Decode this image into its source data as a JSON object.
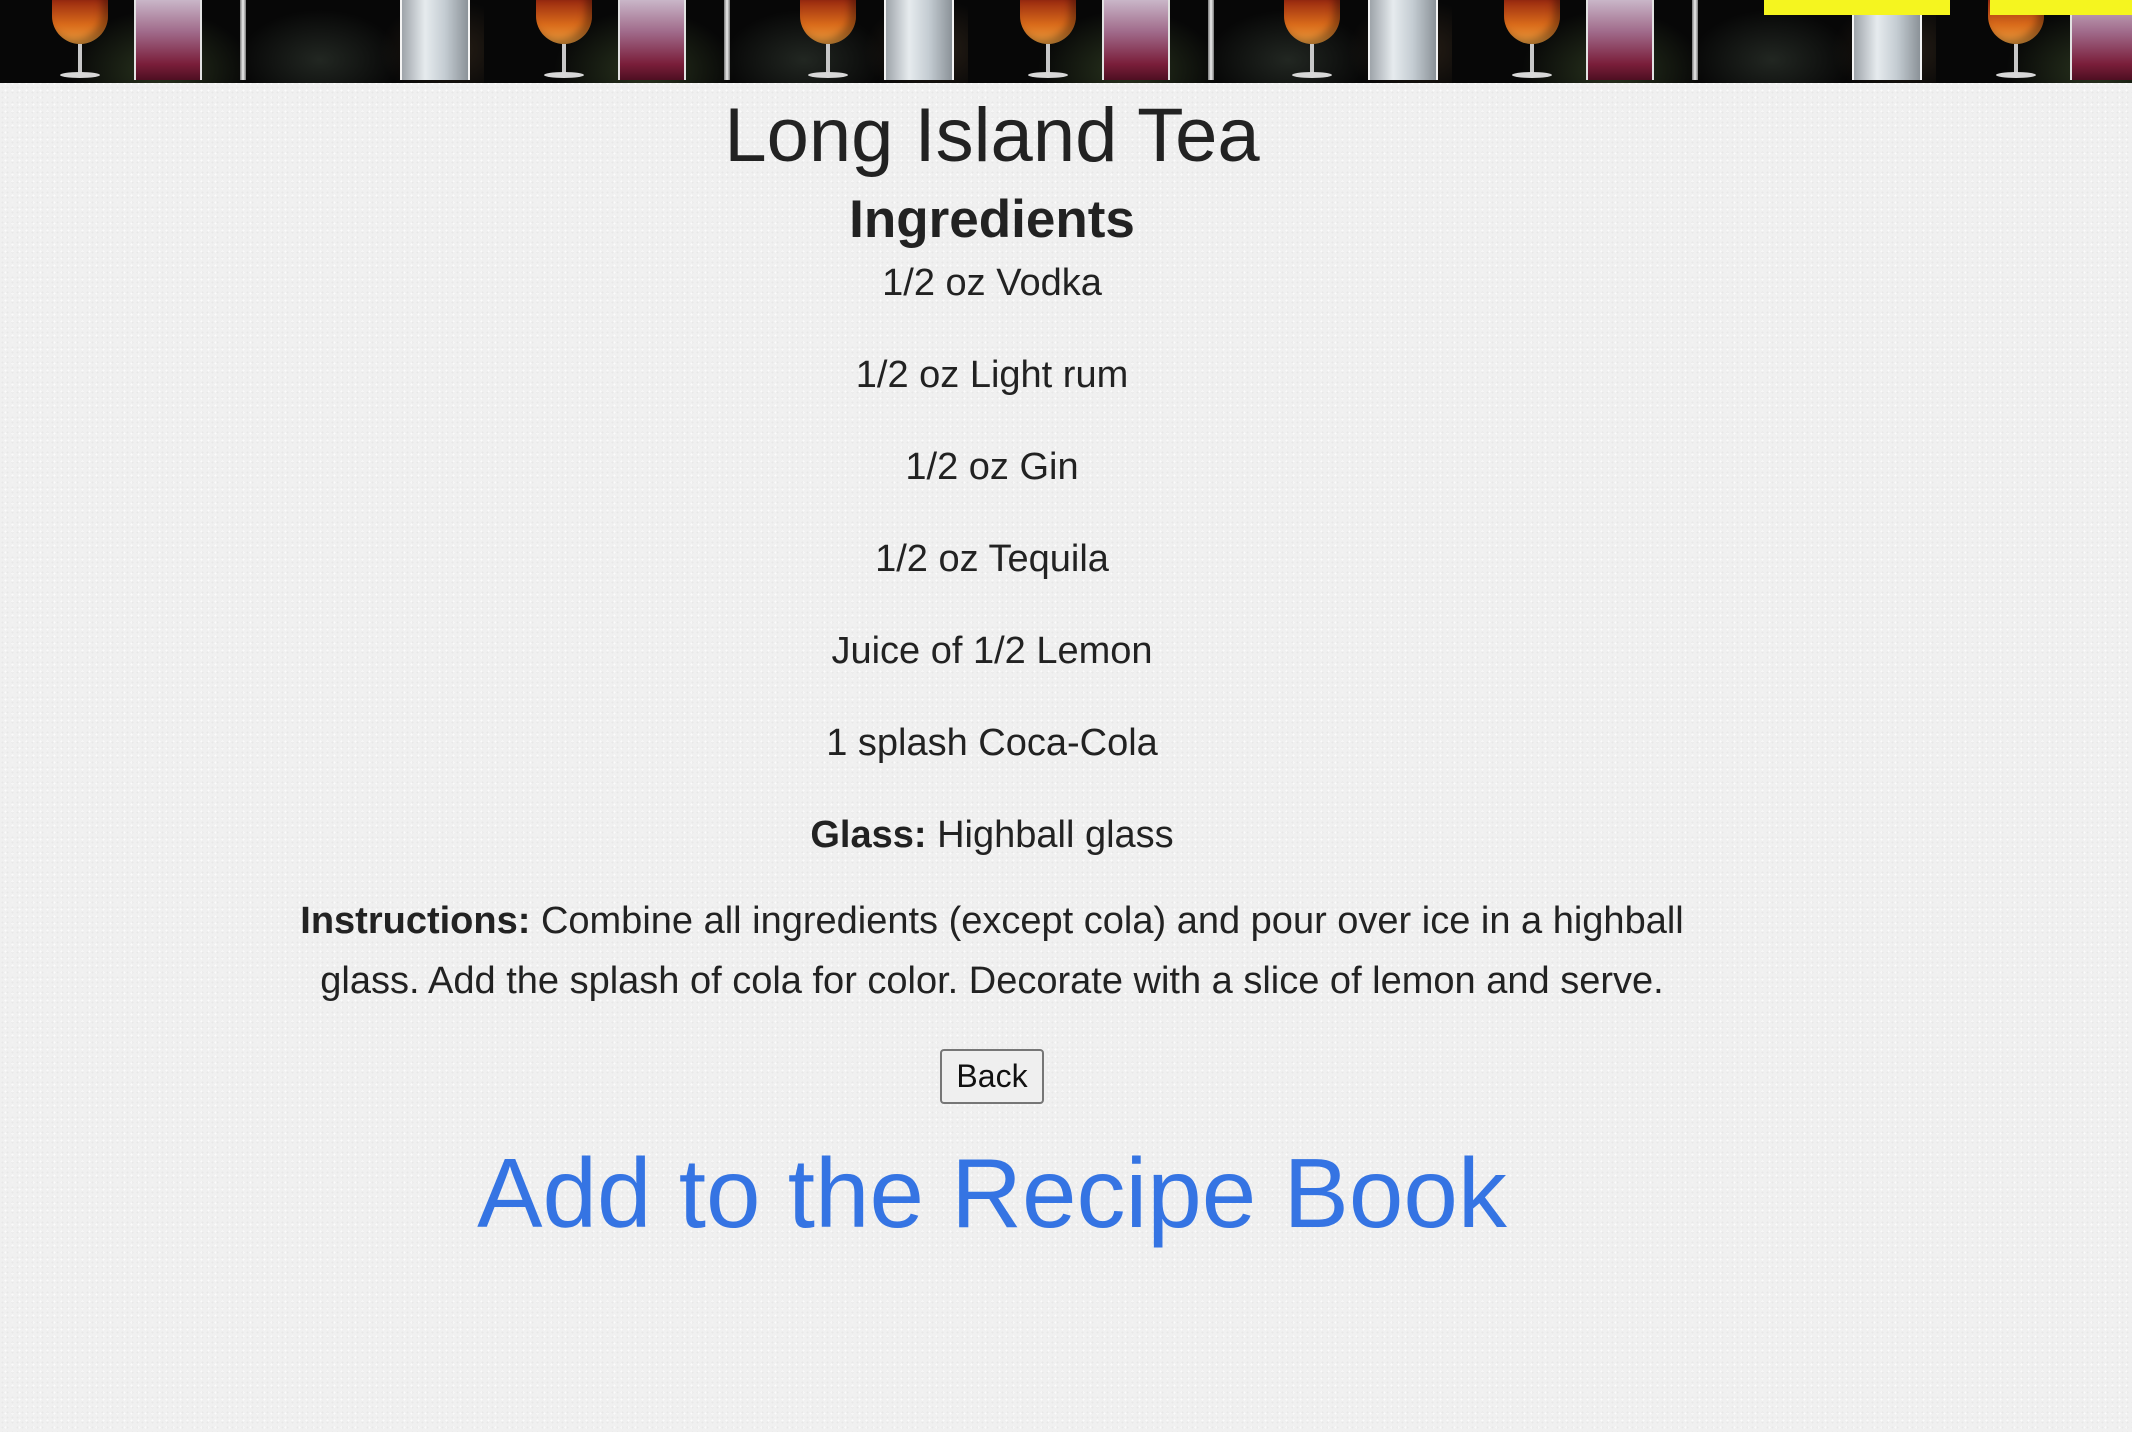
{
  "recipe": {
    "title": "Long Island Tea",
    "ingredients_heading": "Ingredients",
    "ingredients": [
      "1/2 oz Vodka",
      "1/2 oz Light rum",
      "1/2 oz Gin",
      "1/2 oz Tequila",
      "Juice of 1/2 Lemon",
      "1 splash Coca-Cola"
    ],
    "glass_label": "Glass:",
    "glass_value": "Highball glass",
    "instructions_label": "Instructions:",
    "instructions_value": "Combine all ingredients (except cola) and pour over ice in a highball glass. Add the splash of cola for color. Decorate with a slice of lemon and serve."
  },
  "actions": {
    "back_label": "Back",
    "add_link_label": "Add to the Recipe Book"
  },
  "colors": {
    "link_blue": "#3574e3",
    "banner_yellow": "#f5f51f",
    "page_background": "#f0f0f0"
  }
}
